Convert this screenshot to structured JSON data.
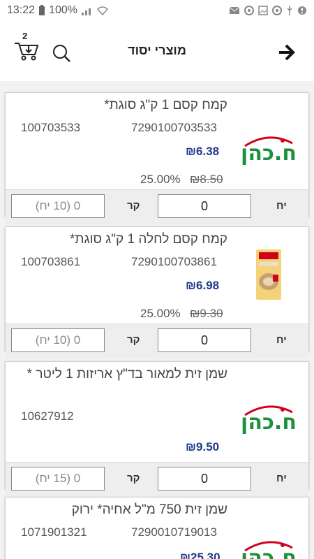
{
  "status_bar": {
    "time": "13:22",
    "battery": "100%"
  },
  "header": {
    "title": "מוצרי יסוד",
    "cart_count": "2"
  },
  "colors": {
    "price": "#1e3a8a",
    "brand_red": "#d0021b",
    "brand_green": "#1a8f3c"
  },
  "products": [
    {
      "name": "קמח קסם  1 ק\"ג סוגת*",
      "barcode": "7290100703533",
      "sku": "100703533",
      "price": "₪6.38",
      "old_price": "₪8.50",
      "discount": "25.00%",
      "unit_label": "יח",
      "qty": "0",
      "box_label": "קר",
      "box_qty": "0 (10 יח)",
      "image": "brand-logo"
    },
    {
      "name": "קמח קסם לחלה 1 ק\"ג סוגת*",
      "barcode": "7290100703861",
      "sku": "100703861",
      "price": "₪6.98",
      "old_price": "₪9.30",
      "discount": "25.00%",
      "unit_label": "יח",
      "qty": "0",
      "box_label": "קר",
      "box_qty": "0 (10 יח)",
      "image": "flour-bag"
    },
    {
      "name": "שמן זית  למאור בד\"ץ אריזות 1 ליטר *",
      "barcode": "",
      "sku": "10627912",
      "price": "₪9.50",
      "unit_label": "יח",
      "qty": "0",
      "box_label": "קר",
      "box_qty": "0 (15 יח)",
      "image": "brand-logo"
    },
    {
      "name": "שמן זית 750 מ\"ל אחיה* ירוק",
      "barcode": "7290010719013",
      "sku": "1071901321",
      "price": "₪25.30",
      "image": "brand-logo"
    }
  ]
}
